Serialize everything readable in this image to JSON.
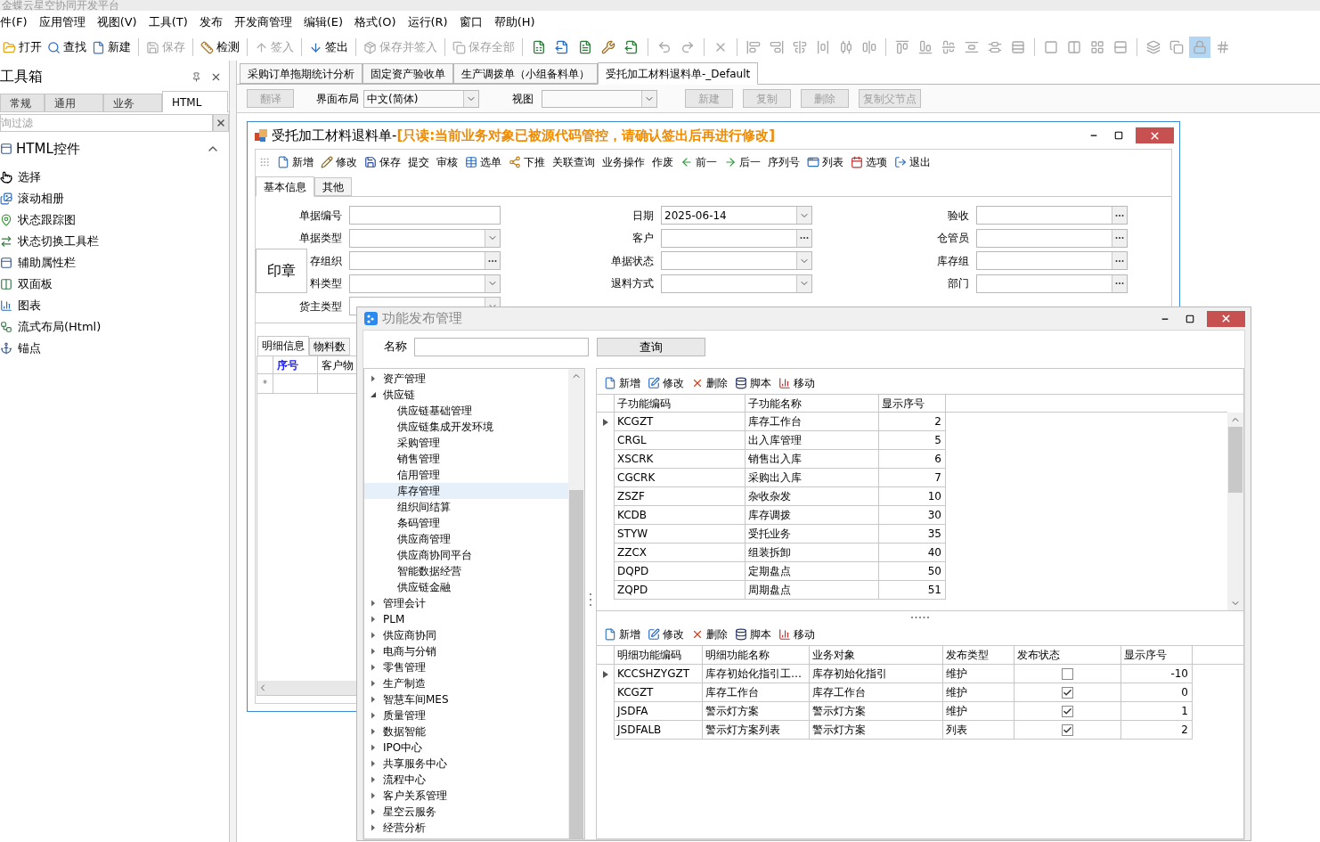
{
  "app_title": "金蝶云星空协同开发平台",
  "menu": [
    "件(F)",
    "应用管理",
    "视图(V)",
    "工具(T)",
    "发布",
    "开发商管理",
    "编辑(E)",
    "格式(O)",
    "运行(R)",
    "窗口",
    "帮助(H)"
  ],
  "toolbar": [
    [
      {
        "label": "打开",
        "disabled": false
      },
      {
        "label": "查找",
        "disabled": false
      },
      {
        "label": "新建",
        "disabled": false
      }
    ],
    [
      {
        "label": "保存",
        "disabled": true
      }
    ],
    [
      {
        "label": "检测",
        "disabled": false
      }
    ],
    [
      {
        "label": "签入",
        "disabled": true
      }
    ],
    [
      {
        "label": "签出",
        "disabled": false
      }
    ],
    [
      {
        "label": "保存并签入",
        "disabled": true
      }
    ],
    [
      {
        "label": "保存全部",
        "disabled": true
      }
    ]
  ],
  "icon_toolbar": [
    [
      {
        "disabled": false,
        "on": false
      },
      {
        "disabled": false,
        "on": false
      },
      {
        "disabled": false,
        "on": false
      },
      {
        "disabled": false,
        "on": false
      },
      {
        "disabled": false,
        "on": false
      }
    ],
    [
      {
        "disabled": true,
        "on": false
      },
      {
        "disabled": true,
        "on": false
      }
    ],
    [
      {
        "disabled": true,
        "on": false
      }
    ],
    [
      {
        "disabled": true,
        "on": false
      },
      {
        "disabled": true,
        "on": false
      },
      {
        "disabled": true,
        "on": false
      },
      {
        "disabled": true,
        "on": false
      },
      {
        "disabled": true,
        "on": false
      },
      {
        "disabled": true,
        "on": false
      }
    ],
    [
      {
        "disabled": true,
        "on": false
      },
      {
        "disabled": true,
        "on": false
      },
      {
        "disabled": true,
        "on": false
      },
      {
        "disabled": true,
        "on": false
      },
      {
        "disabled": true,
        "on": false
      },
      {
        "disabled": true,
        "on": false
      }
    ],
    [
      {
        "disabled": true,
        "on": false
      },
      {
        "disabled": true,
        "on": false
      },
      {
        "disabled": true,
        "on": false
      },
      {
        "disabled": true,
        "on": false
      }
    ],
    [
      {
        "disabled": true,
        "on": false
      },
      {
        "disabled": true,
        "on": false
      },
      {
        "disabled": true,
        "on": true
      },
      {
        "disabled": true,
        "on": false
      }
    ]
  ],
  "toolbox": {
    "title": "工具箱",
    "tabs": [
      {
        "label": "常规",
        "selected": false
      },
      {
        "label": "通用",
        "selected": false
      },
      {
        "label": "业务",
        "selected": false
      },
      {
        "label": "HTML",
        "selected": true
      }
    ],
    "filter": {
      "placeholder": "询过滤"
    },
    "section": {
      "title": "HTML控件",
      "expanded": true
    },
    "items": [
      "选择",
      "滚动相册",
      "状态跟踪图",
      "状态切换工具栏",
      "辅助属性栏",
      "双面板",
      "图表",
      "流式布局(Html)",
      "锚点"
    ]
  },
  "doc_tabs": [
    {
      "label": "采购订单拖期统计分析",
      "selected": false
    },
    {
      "label": "固定资产验收单",
      "selected": false
    },
    {
      "label": "生产调拨单（小组备料单）",
      "selected": false
    },
    {
      "label": "受托加工材料退料单-_Default",
      "selected": true
    }
  ],
  "designer_bar": {
    "translate": {
      "label": "翻译",
      "disabled": true
    },
    "layout_label": "界面布局",
    "layout_value": "中文(简体)",
    "view_label": "视图",
    "buttons": [
      {
        "label": "新建",
        "disabled": true
      },
      {
        "label": "复制",
        "disabled": true
      },
      {
        "label": "删除",
        "disabled": true
      },
      {
        "label": "复制父节点",
        "disabled": true
      }
    ]
  },
  "form_window": {
    "title": "受托加工材料退料单-",
    "notice": "[只读:当前业务对象已被源代码管控，请确认签出后再进行修改]",
    "toolbar": [
      {
        "label": "新增",
        "kind": "icon"
      },
      {
        "label": "修改",
        "kind": "icon"
      },
      {
        "label": "保存",
        "kind": "icon"
      },
      {
        "label": "提交",
        "kind": "text"
      },
      {
        "label": "审核",
        "kind": "text"
      },
      {
        "label": "选单",
        "kind": "icon"
      },
      {
        "label": "下推",
        "kind": "icon"
      },
      {
        "label": "关联查询",
        "kind": "text"
      },
      {
        "label": "业务操作",
        "kind": "text"
      },
      {
        "label": "作废",
        "kind": "text"
      },
      {
        "label": "前一",
        "kind": "icon"
      },
      {
        "label": "后一",
        "kind": "icon"
      },
      {
        "label": "序列号",
        "kind": "text"
      },
      {
        "label": "列表",
        "kind": "icon"
      },
      {
        "label": "选项",
        "kind": "icon"
      },
      {
        "label": "退出",
        "kind": "icon"
      }
    ],
    "tabs": [
      {
        "label": "基本信息",
        "selected": true
      },
      {
        "label": "其他",
        "selected": false
      }
    ],
    "fields": [
      [
        {
          "label": "单据编号",
          "kind": "text"
        },
        {
          "label": "单据类型",
          "kind": "dropdown"
        },
        {
          "label": "存组织",
          "kind": "lookup"
        },
        {
          "label": "料类型",
          "kind": "dropdown"
        },
        {
          "label": "货主类型",
          "kind": "dropdown"
        }
      ],
      [
        {
          "label": "日期",
          "kind": "dropdown",
          "value": "2025-06-14"
        },
        {
          "label": "客户",
          "kind": "lookup"
        },
        {
          "label": "单据状态",
          "kind": "dropdown"
        },
        {
          "label": "退料方式",
          "kind": "dropdown"
        }
      ],
      [
        {
          "label": "验收",
          "kind": "lookup"
        },
        {
          "label": "仓管员",
          "kind": "lookup"
        },
        {
          "label": "库存组",
          "kind": "lookup"
        },
        {
          "label": "部门",
          "kind": "lookup"
        }
      ]
    ],
    "stamp": "印章",
    "detail_tabs": [
      {
        "label": "明细信息",
        "selected": true
      },
      {
        "label": "物料数",
        "selected": false
      }
    ],
    "grid_columns": [
      {
        "label": "序号",
        "kind": "key"
      },
      {
        "label": "客户物",
        "kind": "plain"
      }
    ],
    "new_row_marker": "*"
  },
  "dialog": {
    "title": "功能发布管理",
    "name_label": "名称",
    "query_button": "查询",
    "tree": [
      {
        "label": "资产管理",
        "expanded": false,
        "selected": false
      },
      {
        "label": "供应链",
        "expanded": true,
        "selected": false,
        "children": [
          {
            "label": "供应链基础管理",
            "selected": false
          },
          {
            "label": "供应链集成开发环境",
            "selected": false
          },
          {
            "label": "采购管理",
            "selected": false
          },
          {
            "label": "销售管理",
            "selected": false
          },
          {
            "label": "信用管理",
            "selected": false
          },
          {
            "label": "库存管理",
            "selected": true
          },
          {
            "label": "组织间结算",
            "selected": false
          },
          {
            "label": "条码管理",
            "selected": false
          },
          {
            "label": "供应商管理",
            "selected": false
          },
          {
            "label": "供应商协同平台",
            "selected": false
          },
          {
            "label": "智能数据经营",
            "selected": false
          },
          {
            "label": "供应链金融",
            "selected": false
          }
        ]
      },
      {
        "label": "管理会计",
        "expanded": false,
        "selected": false
      },
      {
        "label": "PLM",
        "expanded": false,
        "selected": false
      },
      {
        "label": "供应商协同",
        "expanded": false,
        "selected": false
      },
      {
        "label": "电商与分销",
        "expanded": false,
        "selected": false
      },
      {
        "label": "零售管理",
        "expanded": false,
        "selected": false
      },
      {
        "label": "生产制造",
        "expanded": false,
        "selected": false
      },
      {
        "label": "智慧车间MES",
        "expanded": false,
        "selected": false
      },
      {
        "label": "质量管理",
        "expanded": false,
        "selected": false
      },
      {
        "label": "数据智能",
        "expanded": false,
        "selected": false
      },
      {
        "label": "IPO中心",
        "expanded": false,
        "selected": false
      },
      {
        "label": "共享服务中心",
        "expanded": false,
        "selected": false
      },
      {
        "label": "流程中心",
        "expanded": false,
        "selected": false
      },
      {
        "label": "客户关系管理",
        "expanded": false,
        "selected": false
      },
      {
        "label": "星空云服务",
        "expanded": false,
        "selected": false
      },
      {
        "label": "经营分析",
        "expanded": false,
        "selected": false
      }
    ],
    "top_toolbar": [
      "新增",
      "修改",
      "删除",
      "脚本",
      "移动"
    ],
    "top_grid": {
      "columns": [
        "子功能编码",
        "子功能名称",
        "显示序号"
      ],
      "rows": [
        {
          "code": "KCGZT",
          "name": "库存工作台",
          "order": "2",
          "selected": true
        },
        {
          "code": "CRGL",
          "name": "出入库管理",
          "order": "5",
          "selected": false
        },
        {
          "code": "XSCRK",
          "name": "销售出入库",
          "order": "6",
          "selected": false
        },
        {
          "code": "CGCRK",
          "name": "采购出入库",
          "order": "7",
          "selected": false
        },
        {
          "code": "ZSZF",
          "name": "杂收杂发",
          "order": "10",
          "selected": false
        },
        {
          "code": "KCDB",
          "name": "库存调拨",
          "order": "30",
          "selected": false
        },
        {
          "code": "STYW",
          "name": "受托业务",
          "order": "35",
          "selected": false
        },
        {
          "code": "ZZCX",
          "name": "组装拆卸",
          "order": "40",
          "selected": false
        },
        {
          "code": "DQPD",
          "name": "定期盘点",
          "order": "50",
          "selected": false
        },
        {
          "code": "ZQPD",
          "name": "周期盘点",
          "order": "51",
          "selected": false
        }
      ]
    },
    "bottom_toolbar": [
      "新增",
      "修改",
      "删除",
      "脚本",
      "移动"
    ],
    "bottom_grid": {
      "columns": [
        "明细功能编码",
        "明细功能名称",
        "业务对象",
        "发布类型",
        "发布状态",
        "显示序号"
      ],
      "rows": [
        {
          "code": "KCCSHZYGZT",
          "name": "库存初始化指引工…",
          "object": "库存初始化指引",
          "type": "维护",
          "published": false,
          "order": "-10",
          "selected": true
        },
        {
          "code": "KCGZT",
          "name": "库存工作台",
          "object": "库存工作台",
          "type": "维护",
          "published": true,
          "order": "0",
          "selected": false
        },
        {
          "code": "JSDFA",
          "name": "警示灯方案",
          "object": "警示灯方案",
          "type": "维护",
          "published": true,
          "order": "1",
          "selected": false
        },
        {
          "code": "JSDFALB",
          "name": "警示灯方案列表",
          "object": "警示灯方案",
          "type": "列表",
          "published": true,
          "order": "2",
          "selected": false
        }
      ]
    }
  }
}
